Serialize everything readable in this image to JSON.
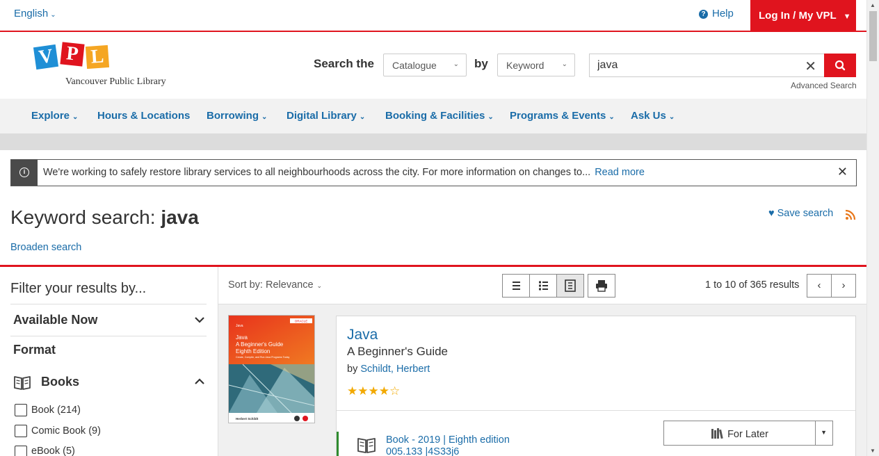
{
  "topbar": {
    "language": "English",
    "help": "Help",
    "login": "Log In / My VPL"
  },
  "header": {
    "logo_letters": [
      "V",
      "P",
      "L"
    ],
    "logo_name": "Vancouver Public Library",
    "search_the": "Search the",
    "scope": "Catalogue",
    "by": "by",
    "search_type": "Keyword",
    "query": "java",
    "advanced": "Advanced Search"
  },
  "nav": {
    "items": [
      "Explore",
      "Hours & Locations",
      "Borrowing",
      "Digital Library",
      "Booking & Facilities",
      "Programs & Events",
      "Ask Us"
    ]
  },
  "alert": {
    "text": "We're working to safely restore library services to all neighbourhoods across the city.  For more information on changes to...",
    "read_more": "Read more"
  },
  "search": {
    "title_prefix": "Keyword search:",
    "title_term": "java",
    "save": "Save search",
    "broaden": "Broaden search"
  },
  "filters": {
    "title": "Filter your results by...",
    "available_now": "Available Now",
    "format": "Format",
    "books": "Books",
    "options": [
      "Book (214)",
      "Comic Book (9)",
      "eBook (5)"
    ]
  },
  "results": {
    "sort": "Sort by: Relevance",
    "range": "1 to 10 of 365 results",
    "items": [
      {
        "title": "Java",
        "subtitle": "A Beginner's Guide",
        "by_label": "by",
        "author": "Schildt, Herbert",
        "rating": 4,
        "rating_max": 5,
        "format": "Book - 2019 | Eighth edition",
        "call_number": "005.133 |4S33j6",
        "action": "For Later",
        "cover": {
          "brand": "ORACLE",
          "series": "Java",
          "title_lines": [
            "Java",
            "A Beginner's Guide",
            "Eighth Edition"
          ],
          "tagline": "Create, Compile, and Run Java Programs Today",
          "author": "Herbert Schildt"
        }
      }
    ]
  },
  "colors": {
    "accent_red": "#e0141e",
    "link_blue": "#1a6ca8",
    "star_gold": "#f2a900",
    "logo_v": "#1f8fd6",
    "logo_p": "#e0141e",
    "logo_l": "#f5a623"
  }
}
